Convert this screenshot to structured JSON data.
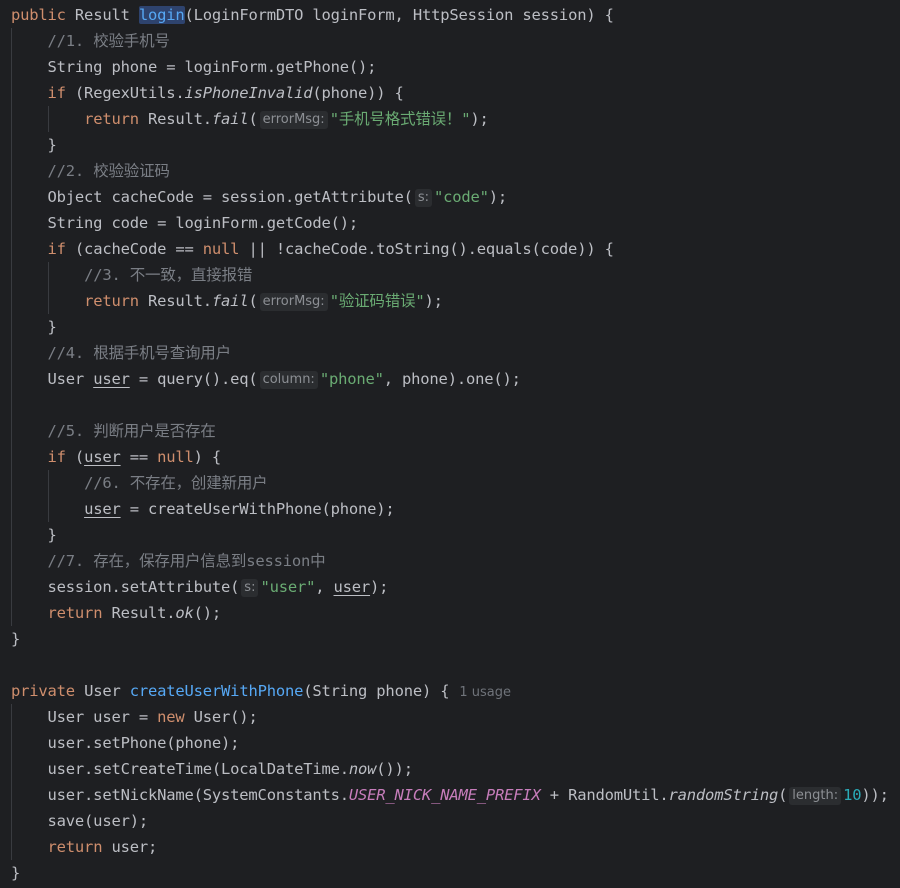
{
  "lines": [
    [
      {
        "t": "public",
        "c": "kw"
      },
      {
        "t": " Result "
      },
      {
        "t": "login",
        "c": "fn-hl"
      },
      {
        "t": "(LoginFormDTO loginForm, HttpSession session) {"
      }
    ],
    [
      {
        "t": "    "
      },
      {
        "t": "//1. 校验手机号",
        "c": "cmt"
      }
    ],
    [
      {
        "t": "    String phone = loginForm.getPhone();"
      }
    ],
    [
      {
        "t": "    "
      },
      {
        "t": "if",
        "c": "kw"
      },
      {
        "t": " (RegexUtils."
      },
      {
        "t": "isPhoneInvalid",
        "c": "it"
      },
      {
        "t": "(phone)) {"
      }
    ],
    [
      {
        "t": "        "
      },
      {
        "t": "return",
        "c": "kw"
      },
      {
        "t": " Result."
      },
      {
        "t": "fail",
        "c": "it"
      },
      {
        "t": "("
      },
      {
        "t": "errorMsg:",
        "c": "hint"
      },
      {
        "t": "\"手机号格式错误！\"",
        "c": "str"
      },
      {
        "t": ");"
      }
    ],
    [
      {
        "t": "    }"
      }
    ],
    [
      {
        "t": "    "
      },
      {
        "t": "//2. 校验验证码",
        "c": "cmt"
      }
    ],
    [
      {
        "t": "    Object cacheCode = session.getAttribute("
      },
      {
        "t": "s:",
        "c": "hint"
      },
      {
        "t": "\"code\"",
        "c": "str"
      },
      {
        "t": ");"
      }
    ],
    [
      {
        "t": "    String code = loginForm.getCode();"
      }
    ],
    [
      {
        "t": "    "
      },
      {
        "t": "if",
        "c": "kw"
      },
      {
        "t": " (cacheCode == "
      },
      {
        "t": "null",
        "c": "kw"
      },
      {
        "t": " || !cacheCode.toString().equals(code)) {"
      }
    ],
    [
      {
        "t": "        "
      },
      {
        "t": "//3. 不一致，直接报错",
        "c": "cmt"
      }
    ],
    [
      {
        "t": "        "
      },
      {
        "t": "return",
        "c": "kw"
      },
      {
        "t": " Result."
      },
      {
        "t": "fail",
        "c": "it"
      },
      {
        "t": "("
      },
      {
        "t": "errorMsg:",
        "c": "hint"
      },
      {
        "t": "\"验证码错误\"",
        "c": "str"
      },
      {
        "t": ");"
      }
    ],
    [
      {
        "t": "    }"
      }
    ],
    [
      {
        "t": "    "
      },
      {
        "t": "//4. 根据手机号查询用户",
        "c": "cmt"
      }
    ],
    [
      {
        "t": "    User "
      },
      {
        "t": "user",
        "c": "ul"
      },
      {
        "t": " = query().eq("
      },
      {
        "t": "column:",
        "c": "hint"
      },
      {
        "t": "\"phone\"",
        "c": "str"
      },
      {
        "t": ", phone).one();"
      }
    ],
    [],
    [
      {
        "t": "    "
      },
      {
        "t": "//5. 判断用户是否存在",
        "c": "cmt"
      }
    ],
    [
      {
        "t": "    "
      },
      {
        "t": "if",
        "c": "kw"
      },
      {
        "t": " ("
      },
      {
        "t": "user",
        "c": "ul"
      },
      {
        "t": " == "
      },
      {
        "t": "null",
        "c": "kw"
      },
      {
        "t": ") {"
      }
    ],
    [
      {
        "t": "        "
      },
      {
        "t": "//6. 不存在，创建新用户",
        "c": "cmt"
      }
    ],
    [
      {
        "t": "        "
      },
      {
        "t": "user",
        "c": "ul"
      },
      {
        "t": " = createUserWithPhone(phone);"
      }
    ],
    [
      {
        "t": "    }"
      }
    ],
    [
      {
        "t": "    "
      },
      {
        "t": "//7. 存在，保存用户信息到session中",
        "c": "cmt"
      }
    ],
    [
      {
        "t": "    session.setAttribute("
      },
      {
        "t": "s:",
        "c": "hint"
      },
      {
        "t": "\"user\"",
        "c": "str"
      },
      {
        "t": ", "
      },
      {
        "t": "user",
        "c": "ul"
      },
      {
        "t": ");"
      }
    ],
    [
      {
        "t": "    "
      },
      {
        "t": "return",
        "c": "kw"
      },
      {
        "t": " Result."
      },
      {
        "t": "ok",
        "c": "it"
      },
      {
        "t": "();"
      }
    ],
    [
      {
        "t": "}"
      }
    ],
    [],
    [
      {
        "t": "private",
        "c": "kw"
      },
      {
        "t": " User "
      },
      {
        "t": "createUserWithPhone",
        "c": "fn"
      },
      {
        "t": "(String phone) {"
      },
      {
        "t": "1 usage",
        "c": "usage"
      }
    ],
    [
      {
        "t": "    User user = "
      },
      {
        "t": "new",
        "c": "kw"
      },
      {
        "t": " User();"
      }
    ],
    [
      {
        "t": "    user.setPhone(phone);"
      }
    ],
    [
      {
        "t": "    user.setCreateTime(LocalDateTime."
      },
      {
        "t": "now",
        "c": "it"
      },
      {
        "t": "());"
      }
    ],
    [
      {
        "t": "    user.setNickName(SystemConstants."
      },
      {
        "t": "USER_NICK_NAME_PREFIX",
        "c": "const"
      },
      {
        "t": " + RandomUtil."
      },
      {
        "t": "randomString",
        "c": "it"
      },
      {
        "t": "("
      },
      {
        "t": "length:",
        "c": "hint"
      },
      {
        "t": "10",
        "c": "num"
      },
      {
        "t": "));"
      }
    ],
    [
      {
        "t": "    save(user);"
      }
    ],
    [
      {
        "t": "    "
      },
      {
        "t": "return",
        "c": "kw"
      },
      {
        "t": " user;"
      }
    ],
    [
      {
        "t": "}"
      }
    ]
  ]
}
